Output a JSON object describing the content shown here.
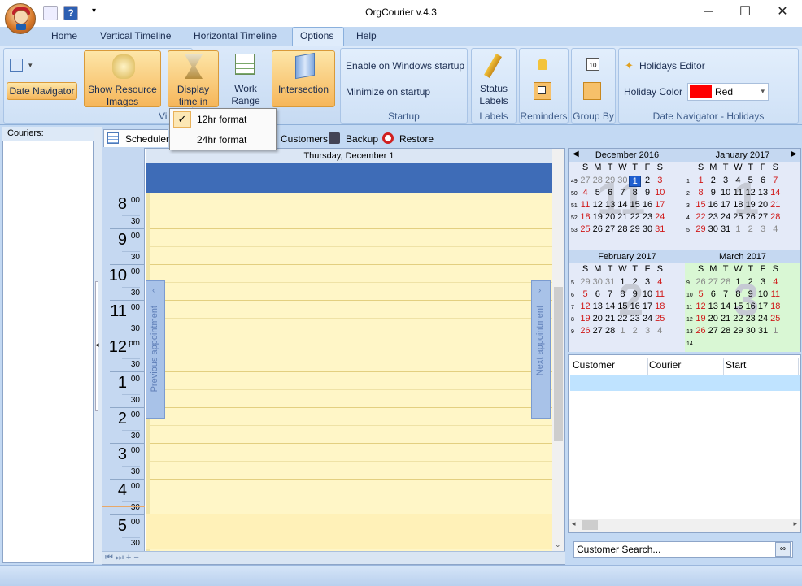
{
  "app": {
    "title": "OrgCourier v.4.3"
  },
  "window_controls": {
    "minimize": "─",
    "maximize": "☐",
    "close": "✕"
  },
  "quick_access": {
    "dropdown": "▾"
  },
  "menu_tabs": [
    "Home",
    "Vertical Timeline",
    "Horizontal Timeline",
    "Options",
    "Help"
  ],
  "ribbon": {
    "date_navigator": "Date Navigator",
    "show_resource_images": [
      "Show Resource",
      "Images"
    ],
    "display_time_in": [
      "Display",
      "time in"
    ],
    "work_range": [
      "Work",
      "Range"
    ],
    "intersection": "Intersection",
    "view_group_partial": "Vi",
    "enable_startup": "Enable on Windows startup",
    "minimize_startup": "Minimize on startup",
    "startup_group": "Startup",
    "status_labels": [
      "Status",
      "Labels"
    ],
    "labels_group": "Labels",
    "reminders_group": "Reminders",
    "group_by_group": "Group By",
    "holidays_editor": "Holidays Editor",
    "holiday_color_label": "Holiday Color",
    "holiday_color_value": "Red",
    "holiday_color_hex": "#ff0000",
    "holidays_group": "Date Navigator - Holidays"
  },
  "time_format_menu": [
    "12hr format",
    "24hr format"
  ],
  "couriers_label": "Couriers:",
  "view_tabs": {
    "scheduler": "Scheduler",
    "customers": "Customers",
    "backup": "Backup",
    "restore": "Restore"
  },
  "scheduler": {
    "day_header": "Thursday, December 1",
    "hours": [
      {
        "h": "8",
        "m": "00"
      },
      {
        "h": "9",
        "m": "00"
      },
      {
        "h": "10",
        "m": "00"
      },
      {
        "h": "11",
        "m": "00"
      },
      {
        "h": "12",
        "m": "pm"
      },
      {
        "h": "1",
        "m": "00"
      },
      {
        "h": "2",
        "m": "00"
      },
      {
        "h": "3",
        "m": "00"
      },
      {
        "h": "4",
        "m": "00"
      },
      {
        "h": "5",
        "m": "00"
      }
    ],
    "half": "30",
    "previous_appointment": "Previous appointment",
    "next_appointment": "Next appointment",
    "nav_glyphs": "⏮ ⏭ + −"
  },
  "calendars": [
    {
      "name": "December 2016",
      "big": "11"
    },
    {
      "name": "January 2017",
      "big": "1"
    },
    {
      "name": "February 2017",
      "big": "2"
    },
    {
      "name": "March 2017",
      "big": "3"
    }
  ],
  "weekdays": [
    "S",
    "M",
    "T",
    "W",
    "T",
    "F",
    "S"
  ],
  "customer_table": {
    "columns": [
      "Customer",
      "Courier",
      "Start"
    ]
  },
  "customer_search": "Customer Search..."
}
